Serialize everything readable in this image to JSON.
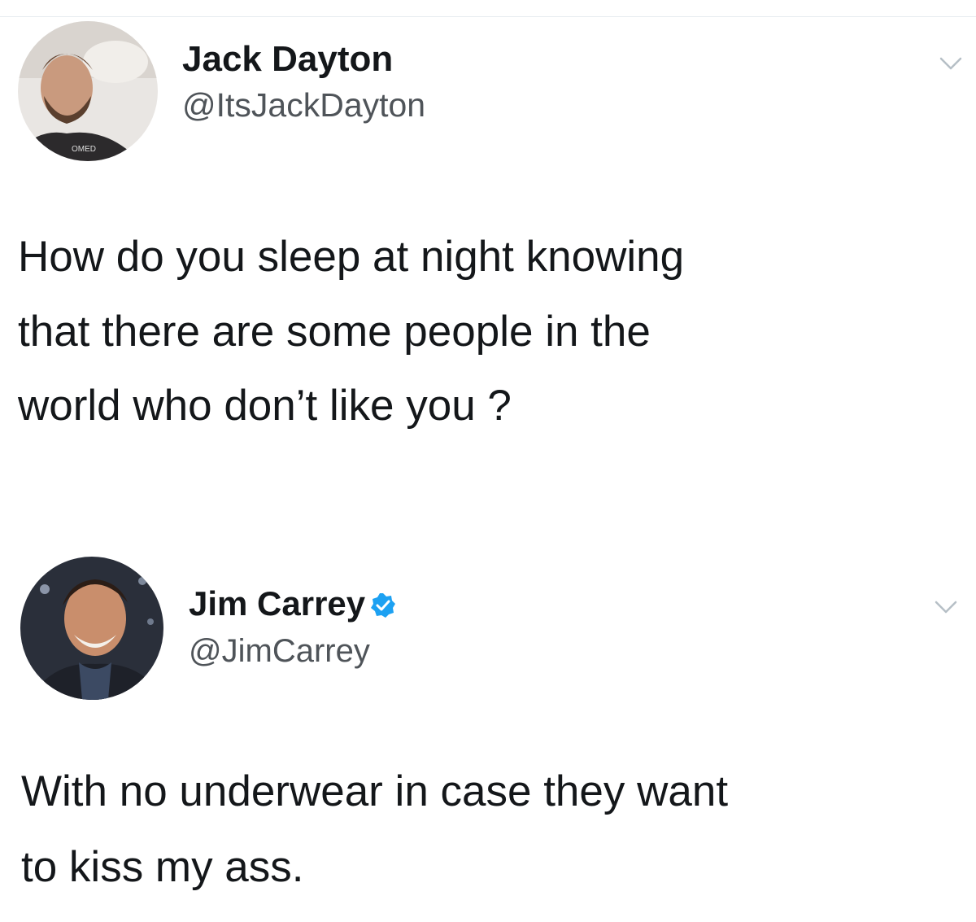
{
  "tweets": [
    {
      "display_name": "Jack Dayton",
      "handle": "@ItsJackDayton",
      "verified": false,
      "avatar_icon": "profile-photo",
      "menu_icon": "chevron-down-icon",
      "text_lines": [
        "How do you sleep at night knowing",
        "that there are some people in the",
        "world who don’t like you ?"
      ]
    },
    {
      "display_name": "Jim Carrey",
      "handle": "@JimCarrey",
      "verified": true,
      "avatar_icon": "profile-photo",
      "badge_icon": "verified-badge-icon",
      "menu_icon": "chevron-down-icon",
      "text_lines": [
        "With no underwear in case they want",
        "to kiss my ass."
      ]
    }
  ],
  "colors": {
    "text": "#14171a",
    "handle": "#4f5459",
    "verified": "#1da1f2",
    "divider": "#e6ecf0",
    "chevron": "#b6bfc6"
  }
}
